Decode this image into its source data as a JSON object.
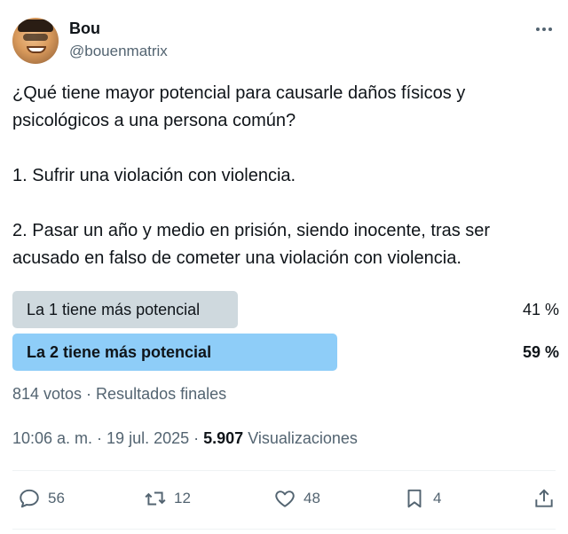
{
  "author": {
    "name": "Bou",
    "handle": "@bouenmatrix",
    "avatar_icon": "avatar"
  },
  "tweet": {
    "text": "¿Qué tiene mayor potencial para causarle daños físicos y psicológicos a una persona común?\n\n1. Sufrir una violación con violencia.\n\n2. Pasar un año y medio en prisión, siendo inocente, tras ser acusado en falso de cometer una violación con violencia."
  },
  "poll": {
    "options": [
      {
        "label": "La 1 tiene más potencial",
        "percent_label": "41 %",
        "percent": 41,
        "color": "#cfd9de",
        "winner": false
      },
      {
        "label": "La 2 tiene más potencial",
        "percent_label": "59 %",
        "percent": 59,
        "color": "#8ecdf8",
        "winner": true
      }
    ],
    "meta": "814 votos · Resultados finales"
  },
  "timestamp": {
    "time_date": "10:06 a. m. · 19 jul. 2025 · ",
    "views_count": "5.907",
    "views_label": "Visualizaciones"
  },
  "actions": {
    "replies": "56",
    "retweets": "12",
    "likes": "48",
    "bookmarks": "4"
  },
  "colors": {
    "text": "#0f1419",
    "secondary": "#536471",
    "winner_bar": "#8ecdf8",
    "other_bar": "#cfd9de"
  }
}
